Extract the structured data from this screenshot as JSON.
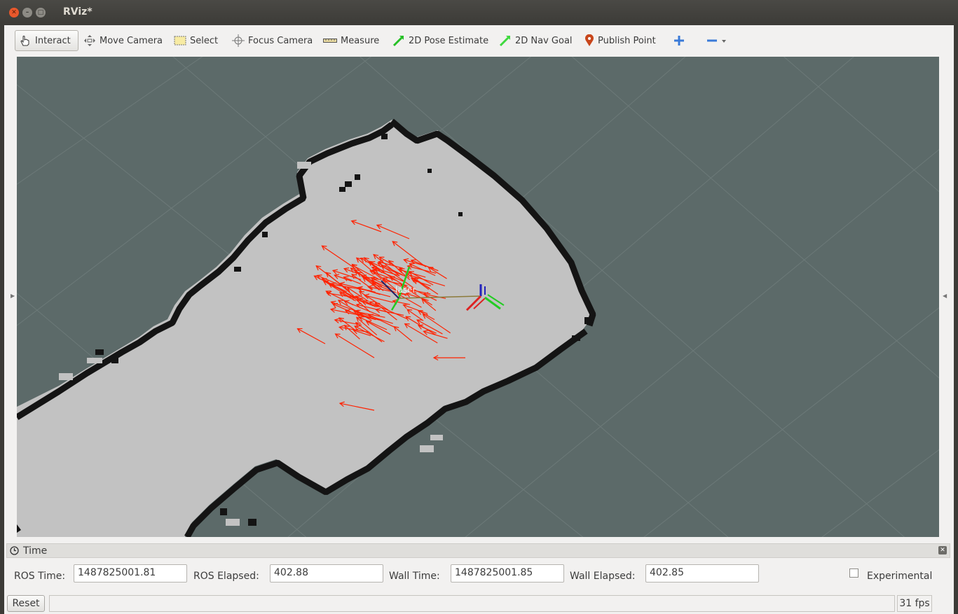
{
  "window": {
    "title": "RViz*"
  },
  "toolbar": {
    "interact": "Interact",
    "move_camera": "Move Camera",
    "select": "Select",
    "focus_camera": "Focus Camera",
    "measure": "Measure",
    "pose_estimate": "2D Pose Estimate",
    "nav_goal": "2D Nav Goal",
    "publish_point": "Publish Point"
  },
  "viewport": {
    "frame_label": "laser"
  },
  "time_panel": {
    "title": "Time",
    "ros_time_label": "ROS Time:",
    "ros_time_value": "1487825001.81",
    "ros_elapsed_label": "ROS Elapsed:",
    "ros_elapsed_value": "402.88",
    "wall_time_label": "Wall Time:",
    "wall_time_value": "1487825001.85",
    "wall_elapsed_label": "Wall Elapsed:",
    "wall_elapsed_value": "402.85",
    "experimental_label": "Experimental",
    "experimental_checked": false
  },
  "status": {
    "reset_label": "Reset",
    "fps": "31 fps"
  },
  "colors": {
    "viewport_bg": "#5c6a69",
    "map_free": "#c2c2c2",
    "map_wall": "#141414",
    "particle_arrow": "#ff2200"
  }
}
